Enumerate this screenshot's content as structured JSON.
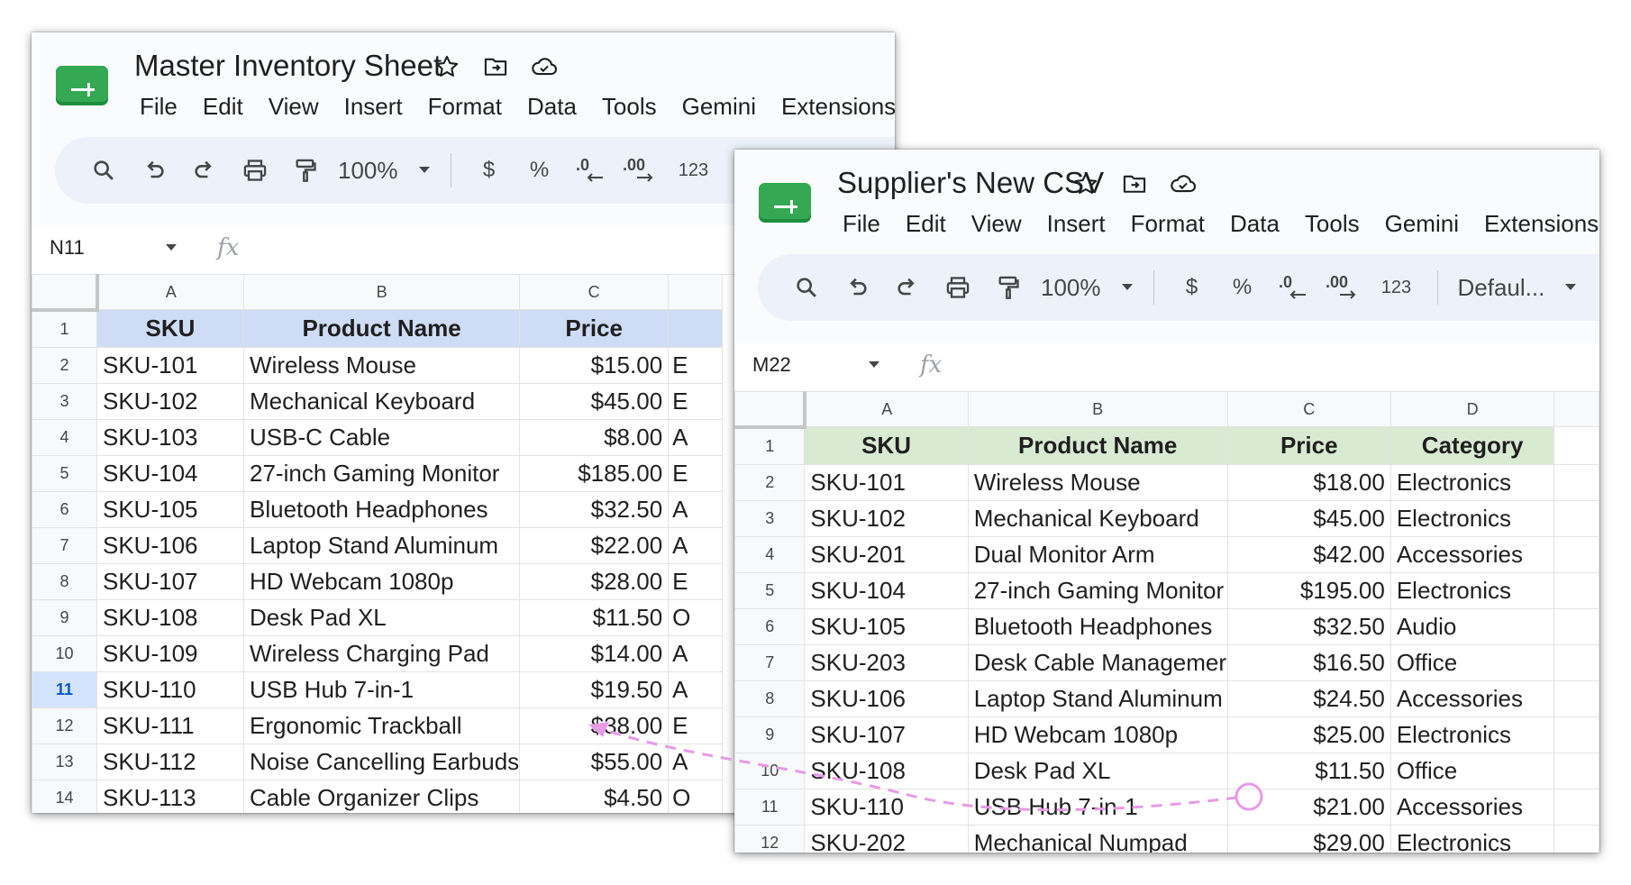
{
  "colors": {
    "app_green": "#34a853",
    "header_blue": "#cfdcf6",
    "header_green": "#d9ead3",
    "annotation_pink": "#e89ae6",
    "selected_row_blue": "#d3e3fd"
  },
  "menu": [
    "File",
    "Edit",
    "View",
    "Insert",
    "Format",
    "Data",
    "Tools",
    "Gemini",
    "Extensions"
  ],
  "toolbar": {
    "zoom": "100%",
    "currency": "$",
    "percent": "%",
    "decrease_decimal": ".0",
    "increase_decimal": ".00",
    "number_format": "123",
    "font": "Defaul..."
  },
  "sheet1": {
    "title": "Master Inventory Sheet",
    "cell_ref": "N11",
    "columns": [
      "A",
      "B",
      "C"
    ],
    "selected_row": 11,
    "headers": [
      "SKU",
      "Product Name",
      "Price"
    ],
    "rows": [
      {
        "n": "2",
        "sku": "SKU-101",
        "name": "Wireless Mouse",
        "price": "$15.00",
        "cut": "E"
      },
      {
        "n": "3",
        "sku": "SKU-102",
        "name": "Mechanical Keyboard",
        "price": "$45.00",
        "cut": "E"
      },
      {
        "n": "4",
        "sku": "SKU-103",
        "name": "USB-C Cable",
        "price": "$8.00",
        "cut": "A"
      },
      {
        "n": "5",
        "sku": "SKU-104",
        "name": "27-inch Gaming Monitor",
        "price": "$185.00",
        "cut": "E"
      },
      {
        "n": "6",
        "sku": "SKU-105",
        "name": "Bluetooth Headphones",
        "price": "$32.50",
        "cut": "A"
      },
      {
        "n": "7",
        "sku": "SKU-106",
        "name": "Laptop Stand Aluminum",
        "price": "$22.00",
        "cut": "A"
      },
      {
        "n": "8",
        "sku": "SKU-107",
        "name": "HD Webcam 1080p",
        "price": "$28.00",
        "cut": "E"
      },
      {
        "n": "9",
        "sku": "SKU-108",
        "name": "Desk Pad XL",
        "price": "$11.50",
        "cut": "O"
      },
      {
        "n": "10",
        "sku": "SKU-109",
        "name": "Wireless Charging Pad",
        "price": "$14.00",
        "cut": "A"
      },
      {
        "n": "11",
        "sku": "SKU-110",
        "name": "USB Hub 7-in-1",
        "price": "$19.50",
        "cut": "A"
      },
      {
        "n": "12",
        "sku": "SKU-111",
        "name": "Ergonomic Trackball",
        "price": "$38.00",
        "cut": "E"
      },
      {
        "n": "13",
        "sku": "SKU-112",
        "name": "Noise Cancelling Earbuds",
        "price": "$55.00",
        "cut": "A"
      },
      {
        "n": "14",
        "sku": "SKU-113",
        "name": "Cable Organizer Clips",
        "price": "$4.50",
        "cut": "O"
      }
    ]
  },
  "sheet2": {
    "title": "Supplier's New CSV",
    "cell_ref": "M22",
    "columns": [
      "A",
      "B",
      "C",
      "D"
    ],
    "headers": [
      "SKU",
      "Product Name",
      "Price",
      "Category"
    ],
    "rows": [
      {
        "n": "2",
        "sku": "SKU-101",
        "name": "Wireless Mouse",
        "price": "$18.00",
        "cat": "Electronics"
      },
      {
        "n": "3",
        "sku": "SKU-102",
        "name": "Mechanical Keyboard",
        "price": "$45.00",
        "cat": "Electronics"
      },
      {
        "n": "4",
        "sku": "SKU-201",
        "name": "Dual Monitor Arm",
        "price": "$42.00",
        "cat": "Accessories"
      },
      {
        "n": "5",
        "sku": "SKU-104",
        "name": "27-inch Gaming Monitor",
        "price": "$195.00",
        "cat": "Electronics"
      },
      {
        "n": "6",
        "sku": "SKU-105",
        "name": "Bluetooth Headphones",
        "price": "$32.50",
        "cat": "Audio"
      },
      {
        "n": "7",
        "sku": "SKU-203",
        "name": "Desk Cable Managemer",
        "price": "$16.50",
        "cat": "Office"
      },
      {
        "n": "8",
        "sku": "SKU-106",
        "name": "Laptop Stand Aluminum",
        "price": "$24.50",
        "cat": "Accessories"
      },
      {
        "n": "9",
        "sku": "SKU-107",
        "name": "HD Webcam 1080p",
        "price": "$25.00",
        "cat": "Electronics"
      },
      {
        "n": "10",
        "sku": "SKU-108",
        "name": "Desk Pad XL",
        "price": "$11.50",
        "cat": "Office"
      },
      {
        "n": "11",
        "sku": "SKU-110",
        "name": "USB Hub 7-in-1",
        "price": "$21.00",
        "cat": "Accessories"
      },
      {
        "n": "12",
        "sku": "SKU-202",
        "name": "Mechanical Numpad",
        "price": "$29.00",
        "cat": "Electronics"
      }
    ]
  }
}
